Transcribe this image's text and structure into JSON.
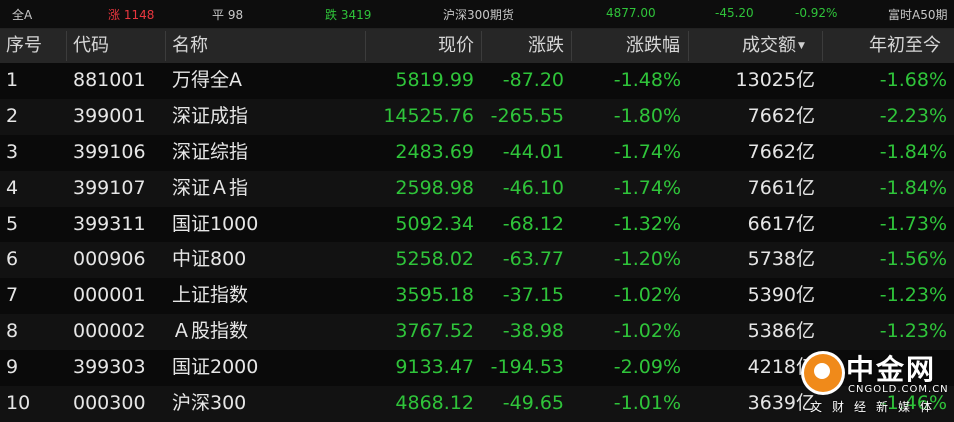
{
  "topbar": {
    "market": "全A",
    "up": "涨 1148",
    "flat": "平 98",
    "down": "跌 3419",
    "future_name": "沪深300期货",
    "future_price": "4877.00",
    "future_change": "-45.20",
    "future_pct": "-0.92%",
    "right_label": "富时A50期"
  },
  "columns": {
    "seq": "序号",
    "code": "代码",
    "name": "名称",
    "price": "现价",
    "change": "涨跌",
    "pct": "涨跌幅",
    "volume": "成交额",
    "ytd": "年初至今"
  },
  "rows": [
    {
      "seq": "1",
      "code": "881001",
      "name": "万得全A",
      "price": "5819.99",
      "change": "-87.20",
      "pct": "-1.48%",
      "volume": "13025亿",
      "ytd": "-1.68%"
    },
    {
      "seq": "2",
      "code": "399001",
      "name": "深证成指",
      "price": "14525.76",
      "change": "-265.55",
      "pct": "-1.80%",
      "volume": "7662亿",
      "ytd": "-2.23%"
    },
    {
      "seq": "3",
      "code": "399106",
      "name": "深证综指",
      "price": "2483.69",
      "change": "-44.01",
      "pct": "-1.74%",
      "volume": "7662亿",
      "ytd": "-1.84%"
    },
    {
      "seq": "4",
      "code": "399107",
      "name": "深证Ａ指",
      "price": "2598.98",
      "change": "-46.10",
      "pct": "-1.74%",
      "volume": "7661亿",
      "ytd": "-1.84%"
    },
    {
      "seq": "5",
      "code": "399311",
      "name": "国证1000",
      "price": "5092.34",
      "change": "-68.12",
      "pct": "-1.32%",
      "volume": "6617亿",
      "ytd": "-1.73%"
    },
    {
      "seq": "6",
      "code": "000906",
      "name": "中证800",
      "price": "5258.02",
      "change": "-63.77",
      "pct": "-1.20%",
      "volume": "5738亿",
      "ytd": "-1.56%"
    },
    {
      "seq": "7",
      "code": "000001",
      "name": "上证指数",
      "price": "3595.18",
      "change": "-37.15",
      "pct": "-1.02%",
      "volume": "5390亿",
      "ytd": "-1.23%"
    },
    {
      "seq": "8",
      "code": "000002",
      "name": "Ａ股指数",
      "price": "3767.52",
      "change": "-38.98",
      "pct": "-1.02%",
      "volume": "5386亿",
      "ytd": "-1.23%"
    },
    {
      "seq": "9",
      "code": "399303",
      "name": "国证2000",
      "price": "9133.47",
      "change": "-194.53",
      "pct": "-2.09%",
      "volume": "4218亿",
      "ytd": ""
    },
    {
      "seq": "10",
      "code": "000300",
      "name": "沪深300",
      "price": "4868.12",
      "change": "-49.65",
      "pct": "-1.01%",
      "volume": "3639亿",
      "ytd": "-1.46%"
    }
  ],
  "watermark": {
    "name": "中金网",
    "domain": "CNGOLD.COM.CN",
    "slogan": "文财经新媒体"
  },
  "colors": {
    "up": "#e8363e",
    "down": "#2fc43a",
    "background": "#0a0a0a",
    "header_bg": "#262626"
  },
  "icons": {
    "sort": "sort-desc-icon",
    "logo": "cngold-logo-icon"
  }
}
